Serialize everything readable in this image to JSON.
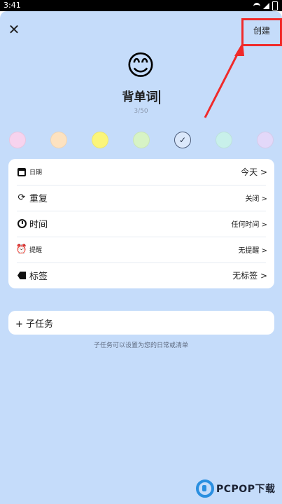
{
  "status_bar": {
    "time": "3:41"
  },
  "header": {
    "close_icon": "✕",
    "create_label": "创建"
  },
  "task": {
    "emoji": "😊",
    "title": "背单词",
    "char_count": "3/50"
  },
  "colors": {
    "swatches": [
      "#f7d3ee",
      "#fde2c0",
      "#fbf57a",
      "#d7f3c5",
      "#dbe8fb",
      "#c8f0ea",
      "#e3d8f9"
    ],
    "selected_index": 4,
    "check_icon": "✓"
  },
  "options": {
    "date": {
      "label": "日期",
      "value": "今天 >"
    },
    "repeat": {
      "label": "重复",
      "value": "关闭 >"
    },
    "time": {
      "label": "时间",
      "value": "任何时间 >"
    },
    "reminder": {
      "label": "提醒",
      "value": "无提醒 >"
    },
    "tags": {
      "label": "标签",
      "value": "无标签 >"
    }
  },
  "subtask": {
    "label": "+ 子任务"
  },
  "hint": "子任务可以设置为您的日常或清单",
  "watermark": {
    "text": "PCPOP下载"
  },
  "accent": {
    "highlight": "#f02a2a",
    "sheet_bg": "#c5dcfa"
  }
}
